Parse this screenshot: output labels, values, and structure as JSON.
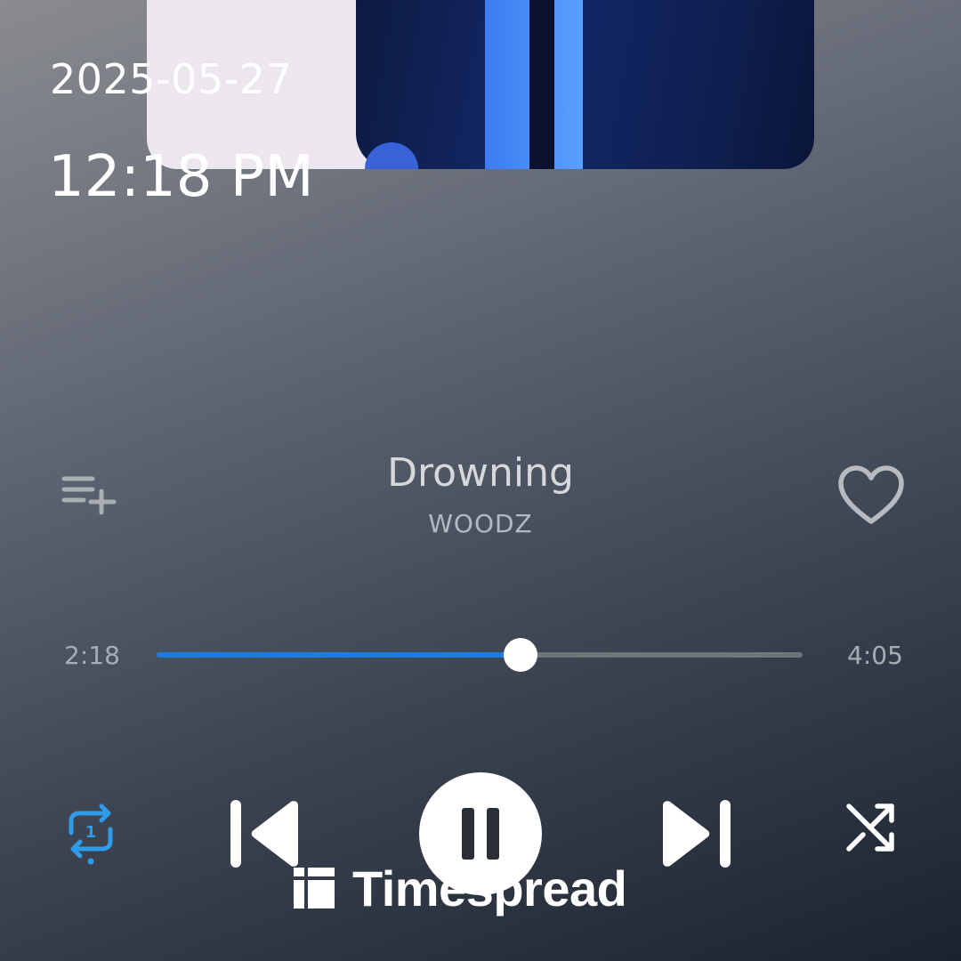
{
  "lockscreen": {
    "date": "2025-05-27",
    "time": "12:18 PM"
  },
  "player": {
    "title": "Drowning",
    "artist": "WOODZ",
    "elapsed": "2:18",
    "duration": "4:05",
    "progress": 0.563,
    "liked": false,
    "repeat_mode": "repeat-one",
    "state": "playing"
  },
  "icons": {
    "queue_add": "playlist-add-icon",
    "like": "heart-outline-icon",
    "repeat": "repeat-one-icon",
    "previous": "skip-previous-icon",
    "play_pause": "pause-icon",
    "next": "skip-next-icon",
    "shuffle": "shuffle-icon"
  },
  "colors": {
    "accent": "#1E7BE0",
    "repeat_active": "#2F9BEA",
    "track_inactive": "#6F747B"
  },
  "watermark": {
    "text": "Timespread"
  }
}
